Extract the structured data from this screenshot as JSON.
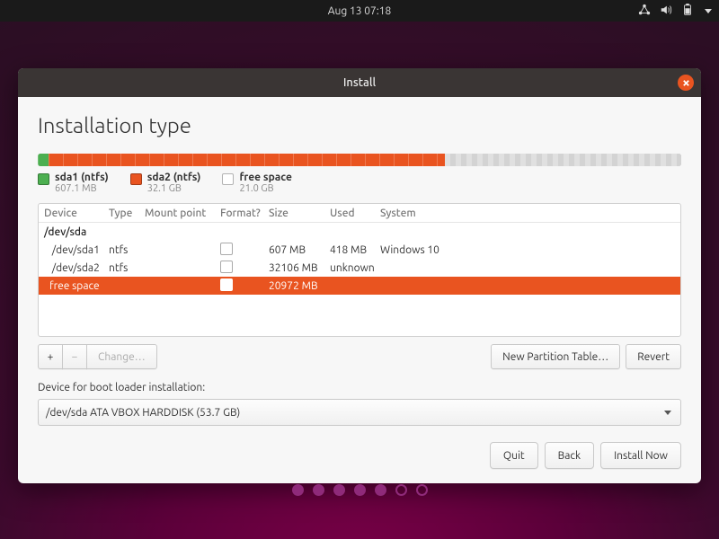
{
  "panel": {
    "clock": "Aug 13  07:18"
  },
  "window": {
    "title": "Install"
  },
  "page": {
    "heading": "Installation type"
  },
  "disk_bar": {
    "segments": [
      {
        "name": "sda1 (ntfs)",
        "size": "607.1 MB",
        "color": "green",
        "pct": 1.7
      },
      {
        "name": "sda2 (ntfs)",
        "size": "32.1 GB",
        "color": "orange",
        "pct": 61.5
      },
      {
        "name": "free space",
        "size": "21.0 GB",
        "color": "free",
        "pct": 36.8
      }
    ]
  },
  "table": {
    "headers": {
      "device": "Device",
      "type": "Type",
      "mount": "Mount point",
      "format": "Format?",
      "size": "Size",
      "used": "Used",
      "system": "System"
    },
    "device_row": "/dev/sda",
    "rows": [
      {
        "device": "/dev/sda1",
        "type": "ntfs",
        "mount": "",
        "format": false,
        "size": "607 MB",
        "used": "418 MB",
        "system": "Windows 10",
        "selected": false
      },
      {
        "device": "/dev/sda2",
        "type": "ntfs",
        "mount": "",
        "format": false,
        "size": "32106 MB",
        "used": "unknown",
        "system": "",
        "selected": false
      },
      {
        "device": "free space",
        "type": "",
        "mount": "",
        "format": true,
        "size": "20972 MB",
        "used": "",
        "system": "",
        "selected": true
      }
    ]
  },
  "toolbar": {
    "add": "+",
    "remove": "−",
    "change": "Change…",
    "new_table": "New Partition Table…",
    "revert": "Revert"
  },
  "bootloader": {
    "label": "Device for boot loader installation:",
    "value": "/dev/sda   ATA VBOX HARDDISK (53.7 GB)"
  },
  "footer": {
    "quit": "Quit",
    "back": "Back",
    "install": "Install Now"
  },
  "progress": {
    "total": 7,
    "current": 5
  }
}
